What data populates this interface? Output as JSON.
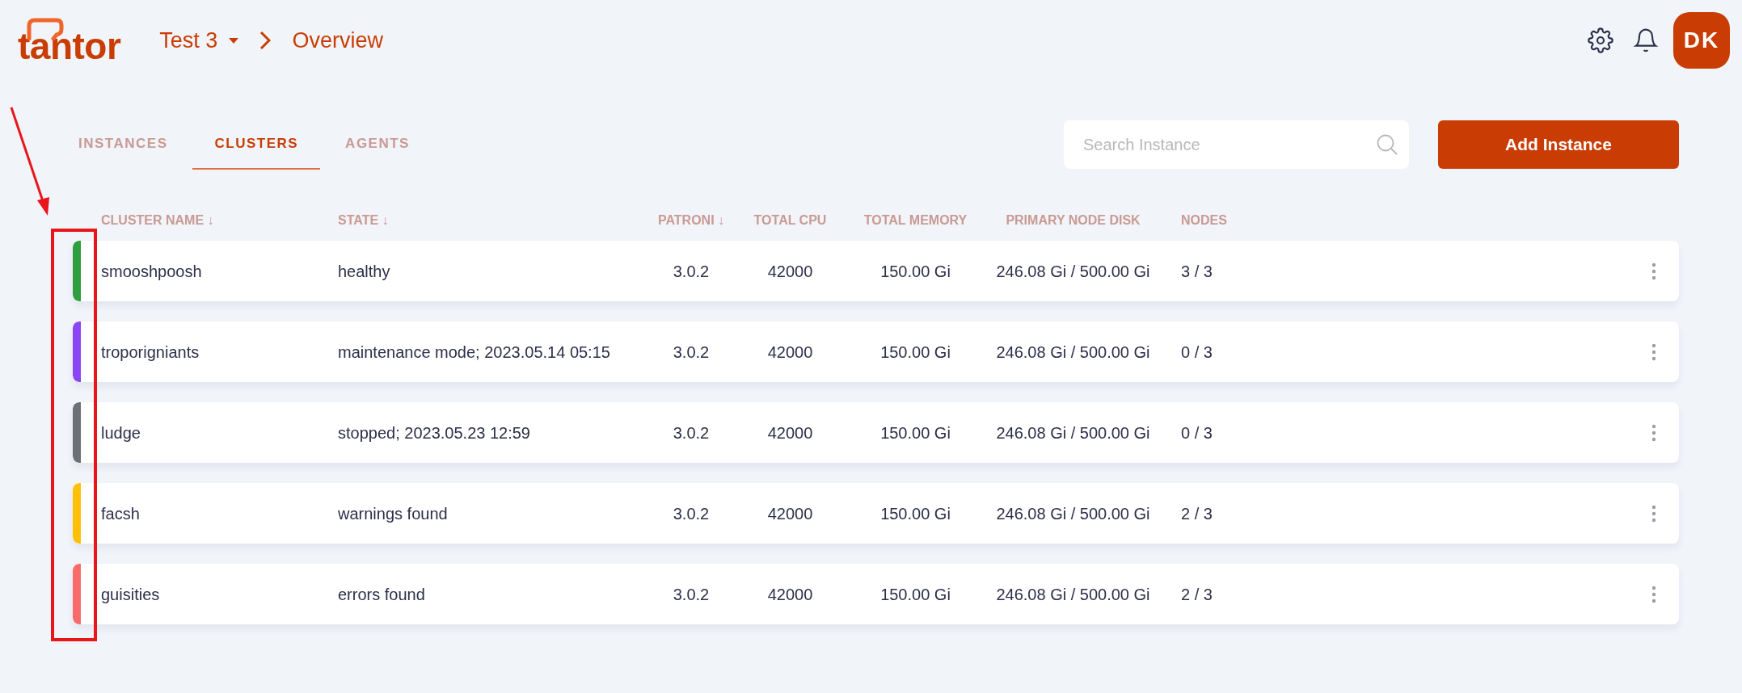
{
  "header": {
    "logo": "tantor",
    "breadcrumb": [
      {
        "label": "Test 3",
        "dropdown": true
      },
      {
        "label": "Overview",
        "dropdown": false
      }
    ],
    "avatar": "DK"
  },
  "tabs": [
    {
      "label": "INSTANCES",
      "selected": false
    },
    {
      "label": "CLUSTERS",
      "selected": true
    },
    {
      "label": "AGENTS",
      "selected": false
    }
  ],
  "search": {
    "placeholder": "Search Instance"
  },
  "add_button": "Add Instance",
  "table": {
    "columns": [
      "CLUSTER NAME ↓",
      "STATE ↓",
      "PATRONI ↓",
      "TOTAL CPU",
      "TOTAL MEMORY",
      "PRIMARY NODE DISK",
      "NODES"
    ],
    "rows": [
      {
        "color": "#2e9e3e",
        "cells": [
          "smooshpoosh",
          "healthy",
          "3.0.2",
          "42000",
          "150.00 Gi",
          "246.08 Gi / 500.00 Gi",
          "3 / 3"
        ]
      },
      {
        "color": "#8b45f5",
        "cells": [
          "troporigniants",
          "maintenance mode; 2023.05.14 05:15",
          "3.0.2",
          "42000",
          "150.00 Gi",
          "246.08 Gi / 500.00 Gi",
          "0 / 3"
        ]
      },
      {
        "color": "#6b6f76",
        "cells": [
          "ludge",
          "stopped; 2023.05.23 12:59",
          "3.0.2",
          "42000",
          "150.00 Gi",
          "246.08 Gi / 500.00 Gi",
          "0 / 3"
        ]
      },
      {
        "color": "#ffc107",
        "cells": [
          "facsh",
          "warnings found",
          "3.0.2",
          "42000",
          "150.00 Gi",
          "246.08 Gi / 500.00 Gi",
          "2 / 3"
        ]
      },
      {
        "color": "#f76b6b",
        "cells": [
          "guisities",
          "errors found",
          "3.0.2",
          "42000",
          "150.00 Gi",
          "246.08 Gi / 500.00 Gi",
          "2 / 3"
        ]
      }
    ]
  },
  "annotation": {
    "arrow": true,
    "box": true
  }
}
